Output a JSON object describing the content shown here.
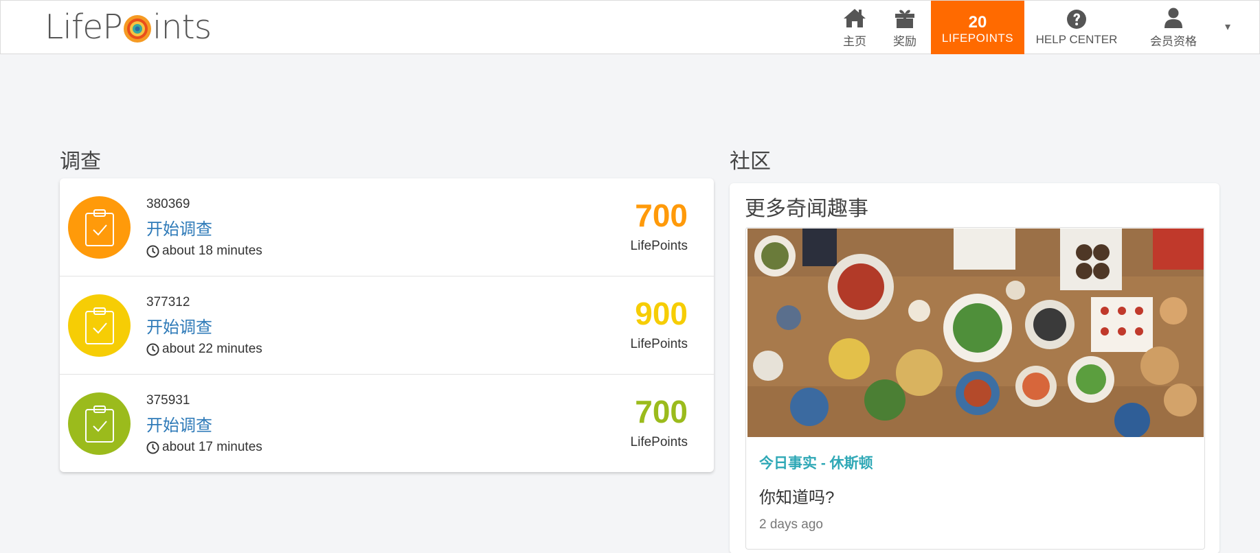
{
  "header": {
    "logo_text_before": "LifeP",
    "logo_text_after": "ints",
    "nav": {
      "home_label": "主页",
      "rewards_label": "奖励",
      "points_value": "20",
      "points_label": "LIFEPOINTS",
      "help_label": "HELP CENTER",
      "member_label": "会员资格",
      "caret": "▾"
    },
    "colors": {
      "points_bg": "#ff6a00"
    }
  },
  "surveys": {
    "title": "调查",
    "items": [
      {
        "id": "380369",
        "link": "开始调查",
        "duration": "about 18 minutes",
        "points": "700",
        "points_label": "LifePoints",
        "color": "#ff9a0a"
      },
      {
        "id": "377312",
        "link": "开始调查",
        "duration": "about 22 minutes",
        "points": "900",
        "points_label": "LifePoints",
        "color": "#f6cd05"
      },
      {
        "id": "375931",
        "link": "开始调查",
        "duration": "about 17 minutes",
        "points": "700",
        "points_label": "LifePoints",
        "color": "#9bbb1c"
      }
    ]
  },
  "community": {
    "title": "社区",
    "subtitle": "更多奇闻趣事",
    "story": {
      "tag": "今日事实 - 休斯顿",
      "title": "你知道吗?",
      "date": "2 days ago"
    }
  }
}
